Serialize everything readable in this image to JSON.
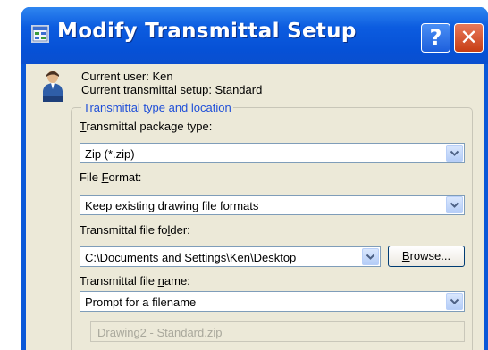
{
  "window": {
    "title": "Modify Transmittal Setup",
    "help_glyph": "?",
    "close_glyph": "✕"
  },
  "user_info": {
    "current_user": "Current user: Ken",
    "current_setup": "Current transmittal setup: Standard"
  },
  "group": {
    "legend": "Transmittal type and location"
  },
  "package_type": {
    "label_u": "T",
    "label_rest": "ransmittal package type:",
    "value": "Zip (*.zip)"
  },
  "file_format": {
    "label_pre": "File ",
    "label_u": "F",
    "label_rest": "ormat:",
    "value": "Keep existing drawing file formats"
  },
  "file_folder": {
    "label_pre": "Transmittal file fo",
    "label_u": "l",
    "label_rest": "der:",
    "value": "C:\\Documents and Settings\\Ken\\Desktop",
    "browse_u": "B",
    "browse_rest": "rowse..."
  },
  "file_name": {
    "label_pre": "Transmittal file ",
    "label_u": "n",
    "label_rest": "ame:",
    "value": "Prompt for a filename",
    "preview": "Drawing2 - Standard.zip"
  },
  "icons": [
    "app-icon",
    "help-icon",
    "close-icon",
    "user-icon",
    "chevron-down-icon"
  ],
  "colors": {
    "titlebar": "#0651d6",
    "dialog_bg": "#ece9d8",
    "legend_text": "#1f4fd8",
    "field_border": "#7f9db9"
  }
}
